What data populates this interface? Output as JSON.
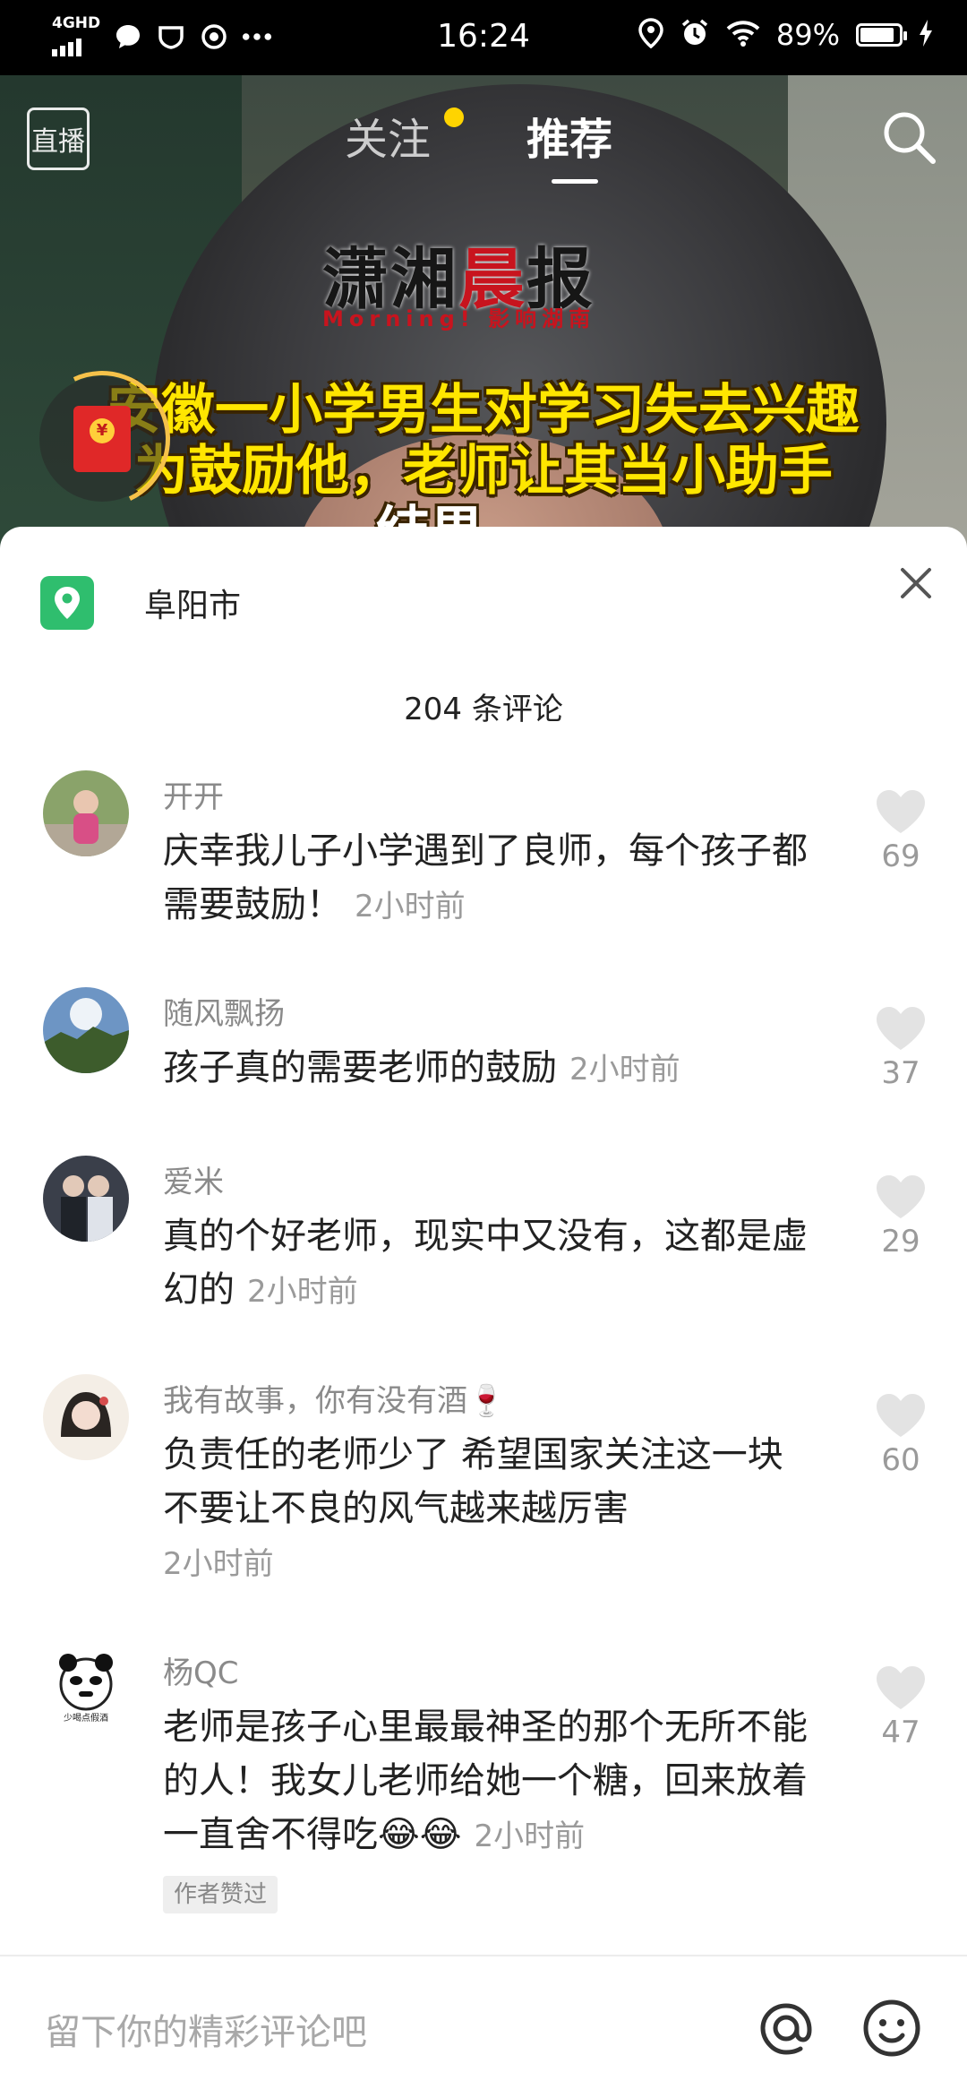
{
  "status_bar": {
    "network": "4GHD",
    "time": "16:24",
    "battery": "89%",
    "battery_level": 0.89,
    "icons": [
      "signal-icon",
      "message-icon",
      "shield-icon",
      "app-icon",
      "more-dots-icon",
      "location-icon",
      "alarm-icon",
      "wifi-icon",
      "battery-icon",
      "charging-icon"
    ]
  },
  "video": {
    "live_label": "直播",
    "tabs": [
      {
        "label": "关注",
        "active": false,
        "has_dot": true
      },
      {
        "label": "推荐",
        "active": true
      }
    ],
    "logo": {
      "part1": "潇湘",
      "part2": "晨",
      "part3": "报",
      "sub": "Morning! 影响湖南"
    },
    "headline": [
      "安徽一小学男生对学习失去兴趣",
      "为鼓励他，老师让其当小助手",
      "结果……"
    ]
  },
  "sheet": {
    "location": "阜阳市",
    "comment_count": "204 条评论",
    "comments": [
      {
        "user": "开开",
        "text": "庆幸我儿子小学遇到了良师，每个孩子都需要鼓励！",
        "time": "2小时前",
        "likes": "69"
      },
      {
        "user": "随风飘扬",
        "text": "孩子真的需要老师的鼓励",
        "time": "2小时前",
        "likes": "37"
      },
      {
        "user": "爱米",
        "text": "真的个好老师，现实中又没有，这都是虚幻的",
        "time": "2小时前",
        "likes": "29"
      },
      {
        "user": "我有故事，你有没有酒🍷",
        "text": "负责任的老师少了 希望国家关注这一块 不要让不良的风气越来越厉害",
        "time": "2小时前",
        "likes": "60"
      },
      {
        "user": "杨QC",
        "text": "老师是孩子心里最最神圣的那个无所不能的人！我女儿老师给她一个糖，回来放着一直舍不得吃😂😂",
        "time": "2小时前",
        "likes": "47",
        "badge": "作者赞过"
      }
    ]
  },
  "input": {
    "placeholder": "留下你的精彩评论吧"
  },
  "colors": {
    "accent_green": "#2fbe6e",
    "headline_yellow": "#ffe600",
    "tab_dot": "#ffd400"
  }
}
